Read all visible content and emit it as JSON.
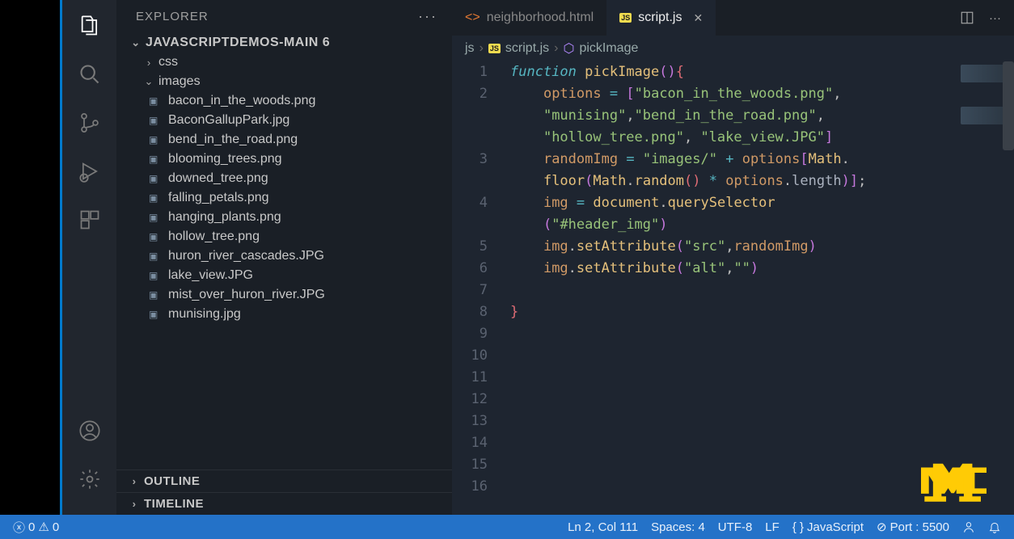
{
  "sidebar": {
    "title": "EXPLORER",
    "root": "JAVASCRIPTDEMOS-MAIN 6",
    "folders": [
      {
        "name": "css",
        "expanded": false
      },
      {
        "name": "images",
        "expanded": true,
        "files": [
          "bacon_in_the_woods.png",
          "BaconGallupPark.jpg",
          "bend_in_the_road.png",
          "blooming_trees.png",
          "downed_tree.png",
          "falling_petals.png",
          "hanging_plants.png",
          "hollow_tree.png",
          "huron_river_cascades.JPG",
          "lake_view.JPG",
          "mist_over_huron_river.JPG",
          "munising.jpg"
        ]
      }
    ],
    "sections": [
      "OUTLINE",
      "TIMELINE"
    ]
  },
  "tabs": [
    {
      "name": "neighborhood.html",
      "type": "html",
      "active": false
    },
    {
      "name": "script.js",
      "type": "js",
      "active": true
    }
  ],
  "breadcrumb": {
    "parts": [
      "js",
      "script.js",
      "pickImage"
    ]
  },
  "code": {
    "line_numbers": [
      "1",
      "2",
      "3",
      "4",
      "5",
      "6",
      "7",
      "8",
      "9",
      "10",
      "11",
      "12",
      "13",
      "14",
      "15",
      "16"
    ]
  },
  "statusbar": {
    "errors": "0",
    "warnings": "0",
    "position": "Ln 2, Col 111",
    "spaces": "Spaces: 4",
    "encoding": "UTF-8",
    "eol": "LF",
    "language": "JavaScript",
    "port": "Port : 5500"
  }
}
